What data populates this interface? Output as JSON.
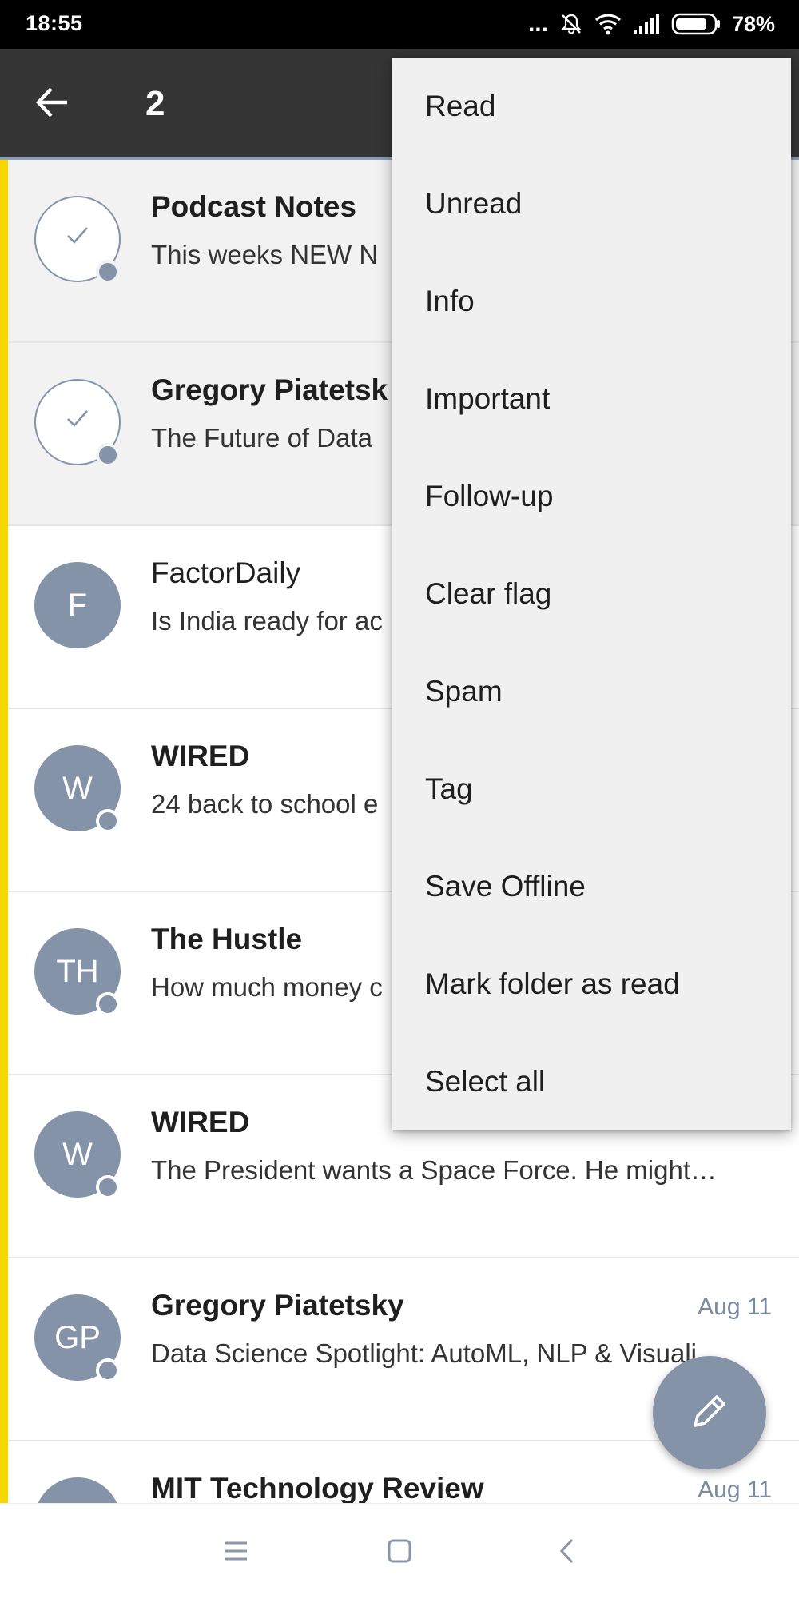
{
  "status_bar": {
    "time": "18:55",
    "dots": "...",
    "battery": "78%"
  },
  "toolbar": {
    "back_icon": "arrow-left-icon",
    "selected_count": "2"
  },
  "emails": [
    {
      "avatar": "",
      "avatar_type": "check",
      "sender": "Podcast Notes",
      "snippet": "This weeks NEW N",
      "date": "",
      "unread": true,
      "selected": true
    },
    {
      "avatar": "",
      "avatar_type": "check",
      "sender": "Gregory Piatetsk",
      "snippet": "The Future of Data",
      "date": "",
      "unread": true,
      "selected": true
    },
    {
      "avatar": "F",
      "avatar_type": "letter",
      "sender": "FactorDaily",
      "snippet": "Is India ready for ac",
      "date": "",
      "unread": false,
      "selected": false
    },
    {
      "avatar": "W",
      "avatar_type": "letter",
      "sender": "WIRED",
      "snippet": "24 back to school e",
      "date": "",
      "unread": true,
      "selected": false
    },
    {
      "avatar": "TH",
      "avatar_type": "letter",
      "sender": "The Hustle",
      "snippet": "How much money c",
      "date": "",
      "unread": true,
      "selected": false
    },
    {
      "avatar": "W",
      "avatar_type": "letter",
      "sender": "WIRED",
      "snippet": "The President wants a Space Force. He might…",
      "date": "",
      "unread": true,
      "selected": false
    },
    {
      "avatar": "GP",
      "avatar_type": "letter",
      "sender": "Gregory Piatetsky",
      "snippet": "Data Science Spotlight: AutoML, NLP & Visuali…",
      "date": "Aug 11",
      "unread": true,
      "selected": false
    },
    {
      "avatar": "",
      "avatar_type": "letter",
      "sender": "MIT Technology Review",
      "snippet": "",
      "date": "Aug 11",
      "unread": true,
      "selected": false
    }
  ],
  "menu": {
    "items": [
      "Read",
      "Unread",
      "Info",
      "Important",
      "Follow-up",
      "Clear flag",
      "Spam",
      "Tag",
      "Save Offline",
      "Mark folder as read",
      "Select all"
    ]
  },
  "fab": {
    "icon": "pencil-icon"
  },
  "nav_bar": {
    "icons": [
      "menu-icon",
      "home-square-icon",
      "back-chevron-icon"
    ]
  },
  "colors": {
    "accent": "#f7d700",
    "avatar": "#8593a9",
    "toolbar": "#353535",
    "menu_bg": "#f0f0f0",
    "date": "#7b8aa1"
  }
}
